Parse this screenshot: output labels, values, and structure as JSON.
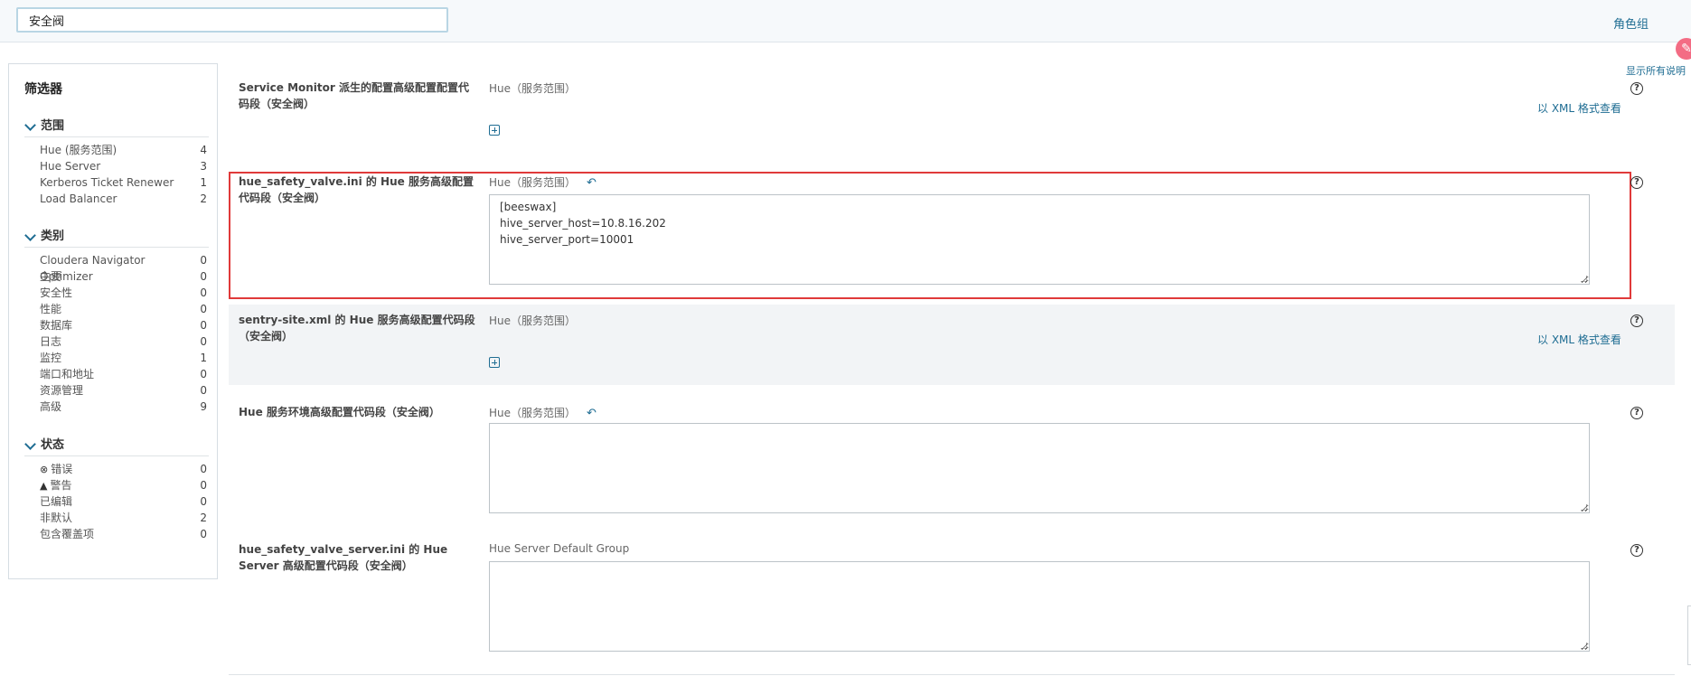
{
  "search": {
    "value": "安全阀"
  },
  "top": {
    "role_group": "角色组",
    "show_all": "显示所有说明"
  },
  "sidebar": {
    "title": "筛选器",
    "scope": {
      "title": "范围",
      "items": [
        {
          "label": "Hue (服务范围)",
          "count": "4"
        },
        {
          "label": "Hue Server",
          "count": "3"
        },
        {
          "label": "Kerberos Ticket Renewer",
          "count": "1"
        },
        {
          "label": "Load Balancer",
          "count": "2"
        }
      ]
    },
    "category": {
      "title": "类别",
      "items": [
        {
          "label": "Cloudera Navigator Optimizer",
          "count": "0"
        },
        {
          "label": "主要",
          "count": "0"
        },
        {
          "label": "安全性",
          "count": "0"
        },
        {
          "label": "性能",
          "count": "0"
        },
        {
          "label": "数据库",
          "count": "0"
        },
        {
          "label": "日志",
          "count": "0"
        },
        {
          "label": "监控",
          "count": "1"
        },
        {
          "label": "端口和地址",
          "count": "0"
        },
        {
          "label": "资源管理",
          "count": "0"
        },
        {
          "label": "高级",
          "count": "9"
        }
      ]
    },
    "status": {
      "title": "状态",
      "items": [
        {
          "label": "错误",
          "count": "0",
          "icon": "error-circle-icon"
        },
        {
          "label": "警告",
          "count": "0",
          "icon": "warning-triangle-icon"
        },
        {
          "label": "已编辑",
          "count": "0"
        },
        {
          "label": "非默认",
          "count": "2"
        },
        {
          "label": "包含覆盖项",
          "count": "0"
        }
      ]
    }
  },
  "configs": [
    {
      "label": "Service Monitor 派生的配置高级配置配置代码段（安全阀）",
      "scope": "Hue（服务范围）",
      "xml": "以 XML 格式查看"
    },
    {
      "label": "hue_safety_valve.ini 的 Hue 服务高级配置代码段（安全阀）",
      "scope": "Hue（服务范围）",
      "value": "[beeswax]\nhive_server_host=10.8.16.202\nhive_server_port=10001"
    },
    {
      "label": "sentry-site.xml 的 Hue 服务高级配置代码段（安全阀）",
      "scope": "Hue（服务范围）",
      "xml": "以 XML 格式查看"
    },
    {
      "label": "Hue 服务环境高级配置代码段（安全阀）",
      "scope": "Hue（服务范围）",
      "value": ""
    },
    {
      "label": "hue_safety_valve_server.ini 的 Hue Server 高级配置代码段（安全阀）",
      "scope": "Hue Server Default Group",
      "value": ""
    }
  ],
  "colors": {
    "accent": "#1f6d93",
    "highlight_border": "#e03a3a"
  }
}
